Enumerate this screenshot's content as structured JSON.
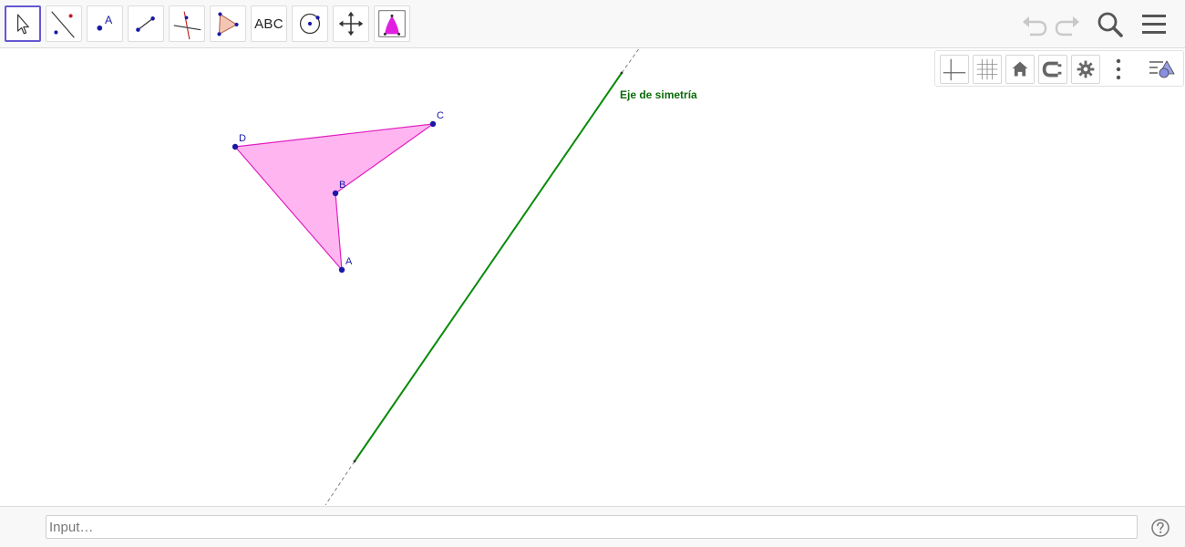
{
  "toolbar": {
    "tools": [
      {
        "id": "move",
        "icon": "move-cursor-icon",
        "selected": true
      },
      {
        "id": "line",
        "icon": "line-through-two-points-icon",
        "selected": false
      },
      {
        "id": "point",
        "icon": "new-point-icon",
        "selected": false
      },
      {
        "id": "segment",
        "icon": "segment-icon",
        "selected": false
      },
      {
        "id": "perpendicular",
        "icon": "perpendicular-line-icon",
        "selected": false
      },
      {
        "id": "polygon",
        "icon": "polygon-icon",
        "selected": false
      },
      {
        "id": "text",
        "icon": "text-icon",
        "label": "ABC",
        "selected": false
      },
      {
        "id": "circle",
        "icon": "circle-with-center-icon",
        "selected": false
      },
      {
        "id": "move-graphics",
        "icon": "move-graphics-view-icon",
        "selected": false
      },
      {
        "id": "custom",
        "icon": "custom-tool-icon",
        "selected": false
      }
    ],
    "right_icons": [
      "undo-icon",
      "redo-icon",
      "search-icon",
      "menu-icon"
    ]
  },
  "stylebar": {
    "buttons": [
      "show-axes-icon",
      "show-grid-icon",
      "standard-view-home-icon",
      "point-capturing-icon",
      "settings-gear-icon",
      "more-options-icon",
      "algebra-view-toggle-icon"
    ]
  },
  "canvas": {
    "points": [
      {
        "name": "A",
        "label": "A"
      },
      {
        "name": "B",
        "label": "B"
      },
      {
        "name": "C",
        "label": "C"
      },
      {
        "name": "D",
        "label": "D"
      }
    ],
    "polygon_fill": "#ffb6f0",
    "polygon_stroke": "#e020c0",
    "point_color": "#1a1aa6",
    "axis_color": "#0a8a0a",
    "axis_label": "Eje de simetría"
  },
  "input": {
    "placeholder": "Input…"
  },
  "colors": {
    "selected_tool_border": "#6557d2",
    "toolbar_bg": "#f8f8f8"
  }
}
